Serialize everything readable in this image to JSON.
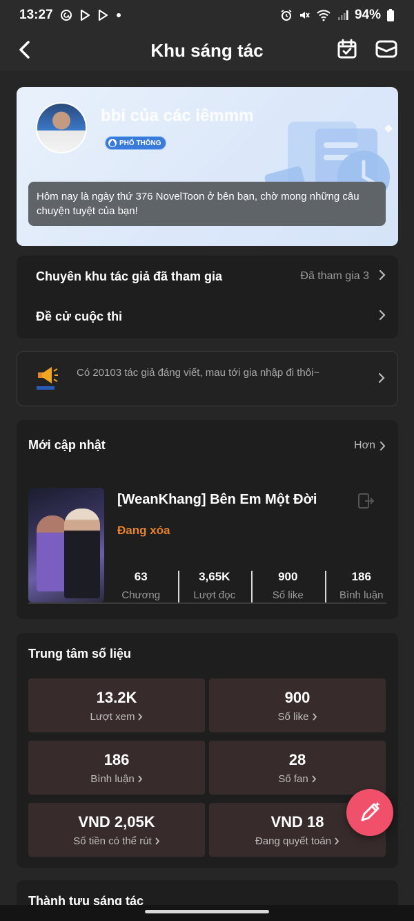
{
  "status_bar": {
    "time": "13:27",
    "battery": "94%",
    "left_icons": [
      "threads-icon",
      "play-icon",
      "play-icon",
      "dot-icon"
    ],
    "right_icons": [
      "alarm-icon",
      "mute-icon",
      "wifi-icon",
      "signal-icon",
      "battery-icon"
    ]
  },
  "header": {
    "title": "Khu sáng tác",
    "icons": [
      "back-icon",
      "calendar-icon",
      "mail-icon"
    ]
  },
  "profile": {
    "username": "bbi của các iêmmm",
    "badge": "PHỔ THÔNG",
    "welcome": "Hôm nay là ngày thứ 376 NovelToon ở bên bạn, chờ mong những câu chuyện tuyệt của bạn!"
  },
  "menu": {
    "items": [
      {
        "label": "Chuyên khu tác giả đã tham gia",
        "value": "Đã tham gia 3"
      },
      {
        "label": "Đề cử cuộc thi",
        "value": ""
      }
    ]
  },
  "notice": {
    "text": "Có 20103 tác giả đáng viết, mau tới gia nhập đi thôi~"
  },
  "recent": {
    "title": "Mới cập nhật",
    "more": "Hơn",
    "book": {
      "title": "[WeanKhang] Bên Em Một Đời",
      "status": "Đang xóa",
      "stats": [
        {
          "value": "63",
          "label": "Chương"
        },
        {
          "value": "3,65K",
          "label": "Lượt đọc"
        },
        {
          "value": "900",
          "label": "Số like"
        },
        {
          "value": "186",
          "label": "Bình luận"
        }
      ]
    }
  },
  "data_center": {
    "title": "Trung tâm số liệu",
    "tiles": [
      {
        "value": "13.2K",
        "label": "Lượt xem"
      },
      {
        "value": "900",
        "label": "Số like"
      },
      {
        "value": "186",
        "label": "Bình luận"
      },
      {
        "value": "28",
        "label": "Số fan"
      },
      {
        "value": "VND 2,05K",
        "label": "Số tiền có thể rút"
      },
      {
        "value": "VND 18",
        "label": "Đang quyết toán"
      }
    ]
  },
  "achievements": {
    "title": "Thành tựu sáng tác"
  },
  "colors": {
    "accent_orange": "#e8822e",
    "fab": "#f0506a",
    "tile_bg": "#382b2b",
    "badge": "#3a7ad8"
  }
}
